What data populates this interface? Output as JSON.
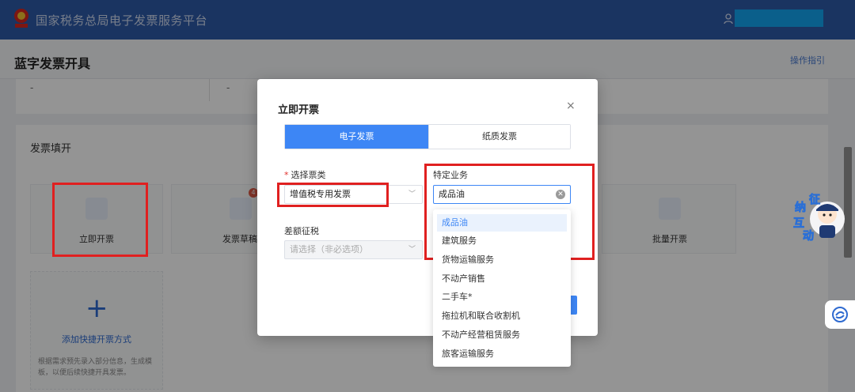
{
  "header": {
    "app_title": "国家税务总局电子发票服务平台"
  },
  "page": {
    "title": "蓝字发票开具",
    "guide_link": "操作指引"
  },
  "background": {
    "placeholder_dash": "-",
    "section_title": "发票填开",
    "options": [
      {
        "label": "立即开票",
        "icon": "invoice-icon"
      },
      {
        "label": "发票草稿",
        "icon": "draft-icon",
        "badge": "4"
      },
      {
        "label": "批量开票",
        "icon": "batch-icon"
      }
    ],
    "add_quick": {
      "label": "添加快捷开票方式",
      "description": "根据需求预先录入部分信息，生成模板，以便后续快捷开具发票。"
    }
  },
  "modal": {
    "title": "立即开票",
    "close_icon": "close-icon",
    "tabs": [
      {
        "label": "电子发票",
        "active": true
      },
      {
        "label": "纸质发票",
        "active": false
      }
    ],
    "invoice_type": {
      "label": "选择票类",
      "required_mark": "*",
      "value": "增值税专用发票"
    },
    "special_business": {
      "label": "特定业务",
      "value": "成品油"
    },
    "difference_tax": {
      "label": "差额征税",
      "placeholder": "请选择（非必选项）"
    }
  },
  "dropdown": {
    "options": [
      "成品油",
      "建筑服务",
      "货物运输服务",
      "不动产销售",
      "二手车*",
      "拖拉机和联合收割机",
      "不动产经营租赁服务",
      "旅客运输服务"
    ],
    "selected": "成品油"
  },
  "widgets": {
    "mascot_text": [
      "纳",
      "征",
      "互",
      "动"
    ]
  },
  "colors": {
    "primary": "#3d86f5",
    "header_bg": "#2e5aa8",
    "highlight": "#e02020"
  }
}
